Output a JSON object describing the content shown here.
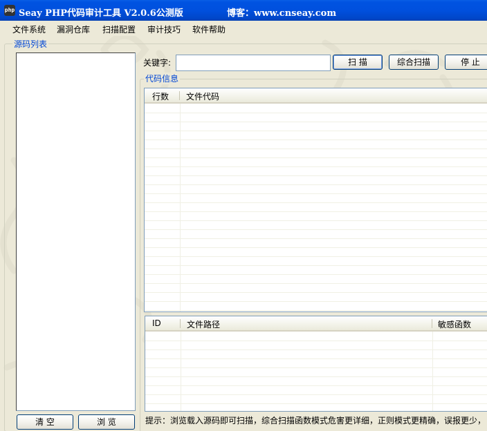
{
  "window": {
    "title": "Seay PHP代码审计工具 V2.0.6公测版",
    "blog": "博客：www.cnseay.com",
    "icon_label": "php"
  },
  "menu": {
    "items": [
      {
        "label": "文件系统"
      },
      {
        "label": "漏洞仓库"
      },
      {
        "label": "扫描配置"
      },
      {
        "label": "审计技巧"
      },
      {
        "label": "软件帮助"
      }
    ]
  },
  "source_panel": {
    "label": "源码列表",
    "clear_button": "清 空",
    "browse_button": "浏 览"
  },
  "search": {
    "keyword_label": "关键字:",
    "keyword_value": "",
    "scan_button": "扫 描",
    "full_scan_button": "综合扫描",
    "stop_button": "停 止"
  },
  "code_info": {
    "label": "代码信息",
    "columns": [
      "行数",
      "文件代码"
    ]
  },
  "results": {
    "columns": [
      "ID",
      "文件路径",
      "敏感函数"
    ]
  },
  "hint": "提示：浏览载入源码即可扫描，综合扫描函数模式危害更详细，正则模式更精确，误报更少，"
}
